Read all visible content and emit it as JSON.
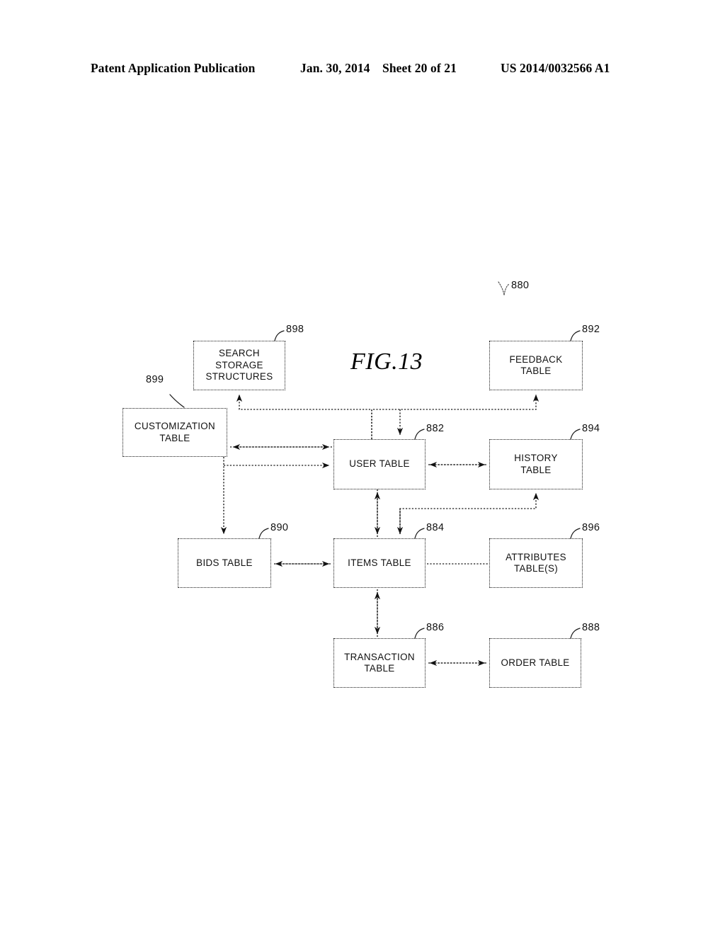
{
  "header": {
    "publication": "Patent Application Publication",
    "date": "Jan. 30, 2014",
    "sheet": "Sheet 20 of 21",
    "patent_number": "US 2014/0032566 A1"
  },
  "figure": {
    "title": "FIG.13",
    "diagram_ref": "880",
    "nodes": [
      {
        "id": "search_storage",
        "label": "SEARCH\nSTORAGE\nSTRUCTURES",
        "ref": "898"
      },
      {
        "id": "customization",
        "label": "CUSTOMIZATION\nTABLE",
        "ref": "899"
      },
      {
        "id": "feedback",
        "label": "FEEDBACK\nTABLE",
        "ref": "892"
      },
      {
        "id": "user",
        "label": "USER TABLE",
        "ref": "882"
      },
      {
        "id": "history",
        "label": "HISTORY\nTABLE",
        "ref": "894"
      },
      {
        "id": "bids",
        "label": "BIDS TABLE",
        "ref": "890"
      },
      {
        "id": "items",
        "label": "ITEMS TABLE",
        "ref": "884"
      },
      {
        "id": "attributes",
        "label": "ATTRIBUTES\nTABLE(S)",
        "ref": "896"
      },
      {
        "id": "transaction",
        "label": "TRANSACTION\nTABLE",
        "ref": "886"
      },
      {
        "id": "order",
        "label": "ORDER TABLE",
        "ref": "888"
      }
    ],
    "connections": [
      {
        "from": "user",
        "to": "search_storage",
        "style": "arrow-single"
      },
      {
        "from": "customization",
        "to": "user",
        "style": "arrow-double"
      },
      {
        "from": "user",
        "to": "feedback",
        "style": "arrow-single"
      },
      {
        "from": "user",
        "to": "history",
        "style": "arrow-double"
      },
      {
        "from": "customization",
        "to": "bids",
        "style": "arrow-single"
      },
      {
        "from": "bids",
        "to": "user",
        "style": "arrow-single"
      },
      {
        "from": "bids",
        "to": "items",
        "style": "arrow-double"
      },
      {
        "from": "user",
        "to": "items",
        "style": "arrow-double"
      },
      {
        "from": "items",
        "to": "history",
        "style": "arrow-single"
      },
      {
        "from": "items",
        "to": "attributes",
        "style": "line"
      },
      {
        "from": "items",
        "to": "transaction",
        "style": "arrow-single"
      },
      {
        "from": "transaction",
        "to": "items",
        "style": "arrow-single"
      },
      {
        "from": "transaction",
        "to": "order",
        "style": "arrow-double"
      }
    ]
  },
  "colors": {
    "ink": "#111111",
    "line": "#1a1a1a",
    "background": "#ffffff"
  }
}
